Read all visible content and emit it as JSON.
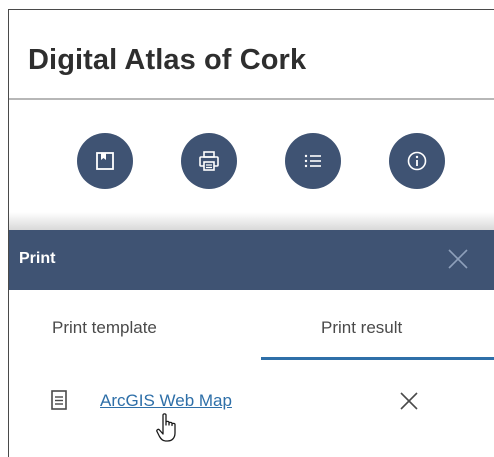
{
  "app": {
    "title": "Digital Atlas of Cork"
  },
  "toolbar": {
    "buttons": [
      {
        "name": "bookmark",
        "icon": "bookmark-icon"
      },
      {
        "name": "print",
        "icon": "printer-icon"
      },
      {
        "name": "layer-list",
        "icon": "list-icon"
      },
      {
        "name": "about",
        "icon": "info-icon"
      }
    ]
  },
  "print_panel": {
    "title": "Print",
    "close_icon": "close-icon",
    "tabs": [
      {
        "label": "Print template",
        "active": false
      },
      {
        "label": "Print result",
        "active": true
      }
    ],
    "results": [
      {
        "label": "ArcGIS Web Map",
        "icon": "document-icon",
        "remove_icon": "close-icon"
      }
    ]
  },
  "colors": {
    "accent": "#3f5373",
    "link": "#2e6fa8",
    "title": "#2e2e2e"
  }
}
